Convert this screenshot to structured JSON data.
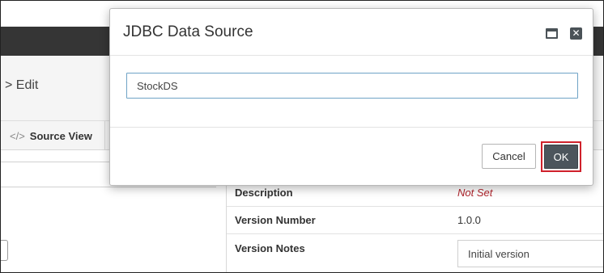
{
  "background": {
    "breadcrumb": "> Edit",
    "source_view_tab": {
      "icon": "code-icon",
      "glyph": "</>",
      "label": "Source View"
    },
    "properties": [
      {
        "label": "Description",
        "value": "Not Set"
      },
      {
        "label": "Version Number",
        "value": "1.0.0"
      },
      {
        "label": "Version Notes",
        "value": "Initial version"
      }
    ]
  },
  "dialog": {
    "title": "JDBC Data Source",
    "name_input": {
      "value": "StockDS"
    },
    "buttons": {
      "cancel": "Cancel",
      "ok": "OK"
    },
    "controls": {
      "maximize_icon": "maximize-icon",
      "close_icon": "close-icon",
      "close_glyph": "✕"
    }
  },
  "colors": {
    "top_bar": "#353535",
    "dialog_button_dark": "#4c555c",
    "highlight_border": "#d0212b",
    "not_set_text": "#b0242c",
    "input_focus_border": "#6fa3c6"
  }
}
